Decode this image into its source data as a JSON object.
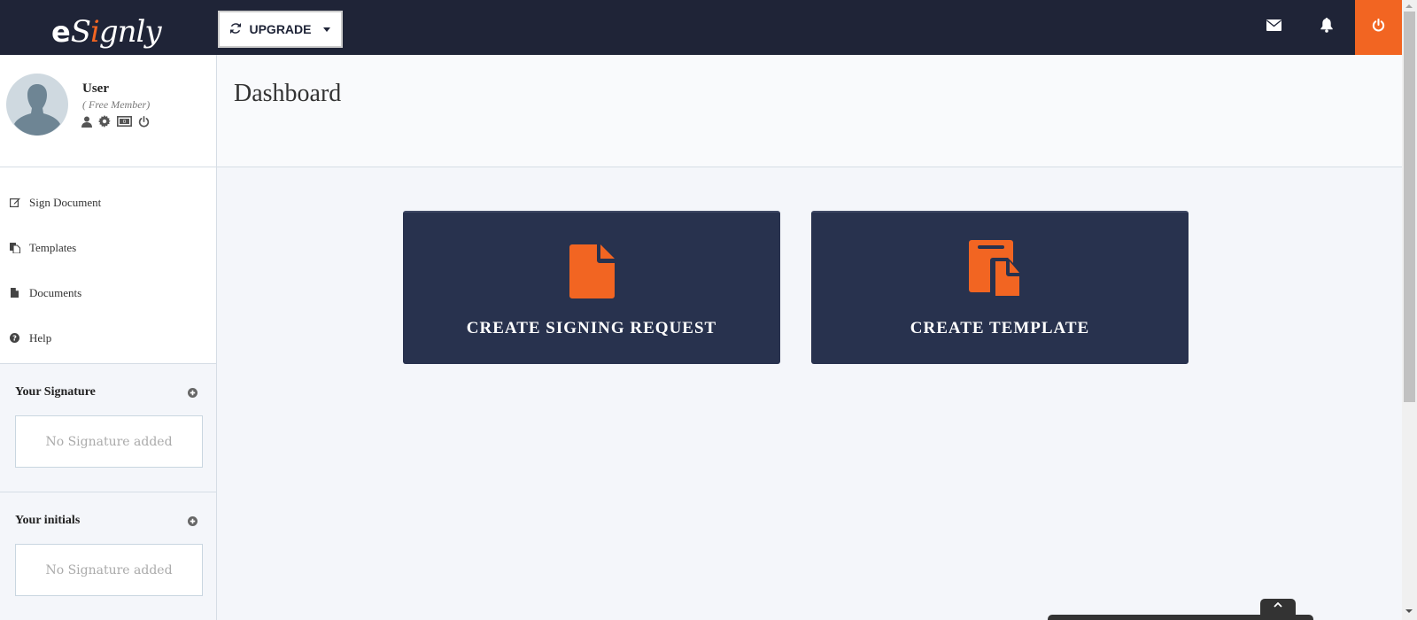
{
  "brand": {
    "logo_e": "e",
    "logo_s": "S",
    "logo_i": "i",
    "logo_rest": "gnly",
    "accent": "#f26522",
    "navy": "#1f2437",
    "card_bg": "#28324e"
  },
  "topbar": {
    "upgrade_label": "UPGRADE",
    "icons": [
      "refresh-icon",
      "mail-icon",
      "bell-icon",
      "power-icon"
    ]
  },
  "profile": {
    "name": "User",
    "tier": "( Free Member)",
    "actions": [
      "user-icon",
      "gear-icon",
      "money-icon",
      "power-icon"
    ]
  },
  "sidebar": {
    "items": [
      {
        "label": "Sign Document",
        "icon": "edit-icon"
      },
      {
        "label": "Templates",
        "icon": "copy-icon"
      },
      {
        "label": "Documents",
        "icon": "file-icon"
      },
      {
        "label": "Help",
        "icon": "question-icon"
      }
    ],
    "signature": {
      "title": "Your Signature",
      "empty": "No Signature added"
    },
    "initials": {
      "title": "Your initials",
      "empty": "No Signature added"
    }
  },
  "main": {
    "title": "Dashboard",
    "cards": [
      {
        "label": "CREATE SIGNING REQUEST",
        "icon": "file-icon"
      },
      {
        "label": "CREATE TEMPLATE",
        "icon": "copy-icon"
      }
    ]
  }
}
